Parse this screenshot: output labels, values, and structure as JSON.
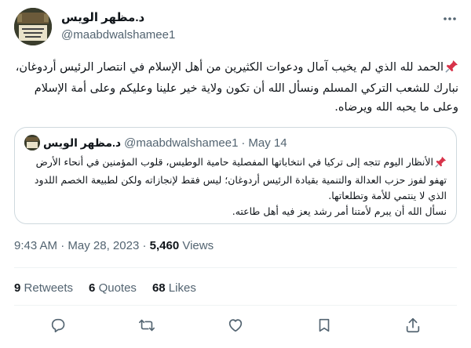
{
  "author": {
    "display_name": "د.مظهر الويس",
    "handle": "@maabdwalshamee1"
  },
  "tweet": {
    "pin_emoji": "📌",
    "text": "الحمد لله الذي لم يخيب آمال ودعوات الكثيرين من أهل الإسلام في انتصار الرئيس أردوغان، نبارك للشعب التركي المسلم ونسأل الله أن تكون ولاية خير علينا وعليكم وعلى أمة الإسلام وعلى ما يحبه الله ويرضاه."
  },
  "quoted": {
    "display_name": "د.مظهر الويس",
    "handle": "@maabdwalshamee1",
    "separator": "·",
    "date": "May 14",
    "text_line1": "الأنظار اليوم تتجه إلى تركيا في انتخاباتها المفصلية حامية الوطيس، قلوب المؤمنين في أنحاء الأرض تهفو لفوز حزب العدالة والتنمية بقيادة الرئيس أردوغان؛ ليس فقط لإنجازاته ولكن لطبيعة الخصم اللدود الذي لا ينتمي للأمة وتطلعاتها.",
    "text_line2": "نسأل الله أن يبرم لأمتنا أمر رشد يعز فيه أهل طاعته."
  },
  "meta": {
    "time": "9:43 AM",
    "separator": "·",
    "date": "May 28, 2023",
    "views_count": "5,460",
    "views_label": "Views"
  },
  "stats": {
    "retweets_count": "9",
    "retweets_label": "Retweets",
    "quotes_count": "6",
    "quotes_label": "Quotes",
    "likes_count": "68",
    "likes_label": "Likes"
  },
  "icons": {
    "more": "more-icon",
    "reply": "reply-icon",
    "retweet": "retweet-icon",
    "like": "heart-icon",
    "bookmark": "bookmark-icon",
    "share": "share-icon",
    "pin": "pushpin-icon"
  },
  "colors": {
    "secondary_text": "#536471",
    "border": "#cfd9de",
    "pin_red": "#d8334a"
  }
}
